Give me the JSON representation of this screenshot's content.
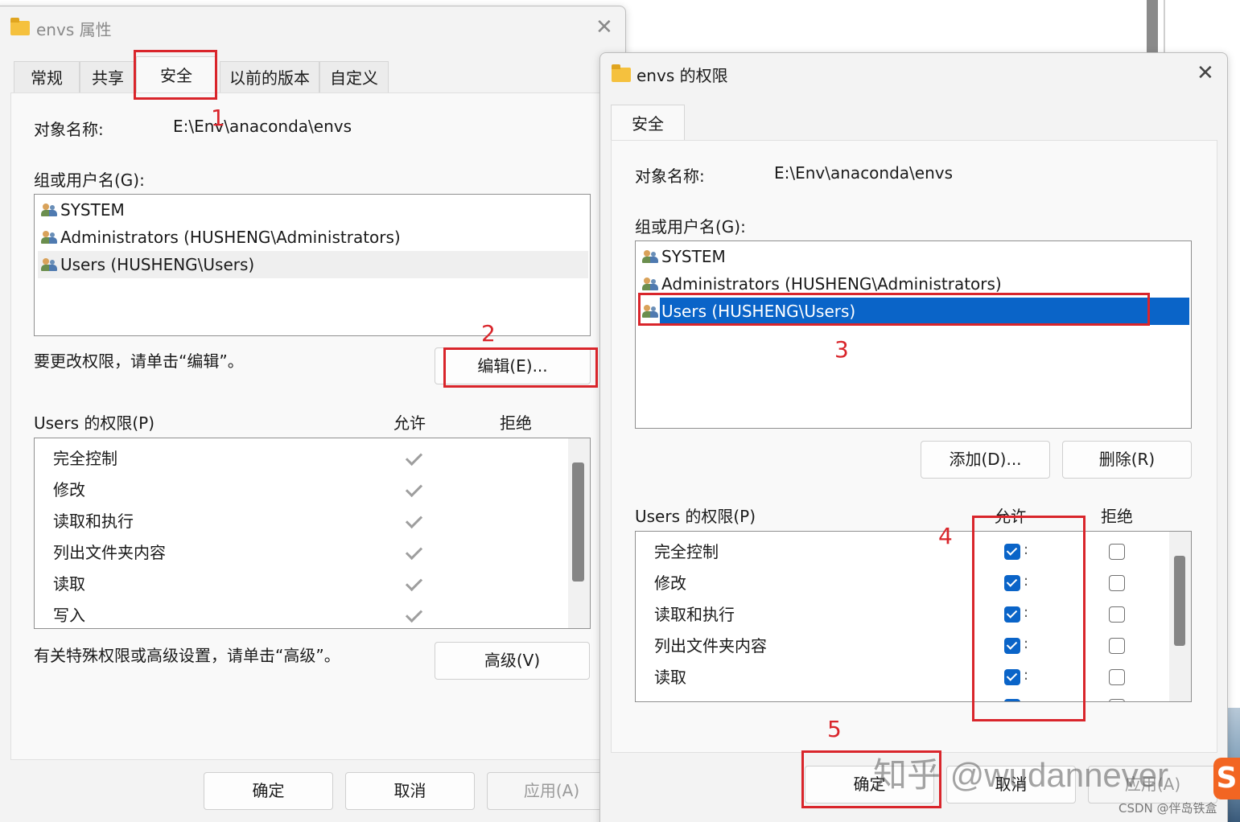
{
  "left_dialog": {
    "title": "envs 属性",
    "tabs": [
      {
        "label": "常规"
      },
      {
        "label": "共享"
      },
      {
        "label": "安全"
      },
      {
        "label": "以前的版本"
      },
      {
        "label": "自定义"
      }
    ],
    "object_name_label": "对象名称:",
    "object_name_value": "E:\\Env\\anaconda\\envs",
    "group_label": "组或用户名(G):",
    "users": [
      {
        "name": "SYSTEM"
      },
      {
        "name": "Administrators (HUSHENG\\Administrators)"
      },
      {
        "name": "Users (HUSHENG\\Users)"
      }
    ],
    "edit_hint": "要更改权限，请单击“编辑”。",
    "edit_button": "编辑(E)...",
    "perm_title": "Users 的权限(P)",
    "allow_header": "允许",
    "deny_header": "拒绝",
    "permissions": [
      {
        "name": "完全控制"
      },
      {
        "name": "修改"
      },
      {
        "name": "读取和执行"
      },
      {
        "name": "列出文件夹内容"
      },
      {
        "name": "读取"
      },
      {
        "name": "写入"
      }
    ],
    "advanced_hint": "有关特殊权限或高级设置，请单击“高级”。",
    "advanced_button": "高级(V)",
    "ok_button": "确定",
    "cancel_button": "取消",
    "apply_button": "应用(A)"
  },
  "right_dialog": {
    "title": "envs 的权限",
    "tab": "安全",
    "object_name_label": "对象名称:",
    "object_name_value": "E:\\Env\\anaconda\\envs",
    "group_label": "组或用户名(G):",
    "users": [
      {
        "name": "SYSTEM"
      },
      {
        "name": "Administrators (HUSHENG\\Administrators)"
      },
      {
        "name": "Users (HUSHENG\\Users)"
      }
    ],
    "add_button": "添加(D)...",
    "remove_button": "删除(R)",
    "perm_title": "Users 的权限(P)",
    "allow_header": "允许",
    "deny_header": "拒绝",
    "permissions": [
      {
        "name": "完全控制"
      },
      {
        "name": "修改"
      },
      {
        "name": "读取和执行"
      },
      {
        "name": "列出文件夹内容"
      },
      {
        "name": "读取"
      }
    ],
    "ok_button": "确定",
    "cancel_button": "取消",
    "apply_button": "应用(A)"
  },
  "annotations": {
    "step1": "1",
    "step2": "2",
    "step3": "3",
    "step4": "4",
    "step5": "5"
  },
  "watermark": "知乎 @wudannever",
  "csdn_mark": "CSDN @伴岛铁盒",
  "colors": {
    "accent": "#0a64c8",
    "annotation_red": "#d9252b"
  }
}
